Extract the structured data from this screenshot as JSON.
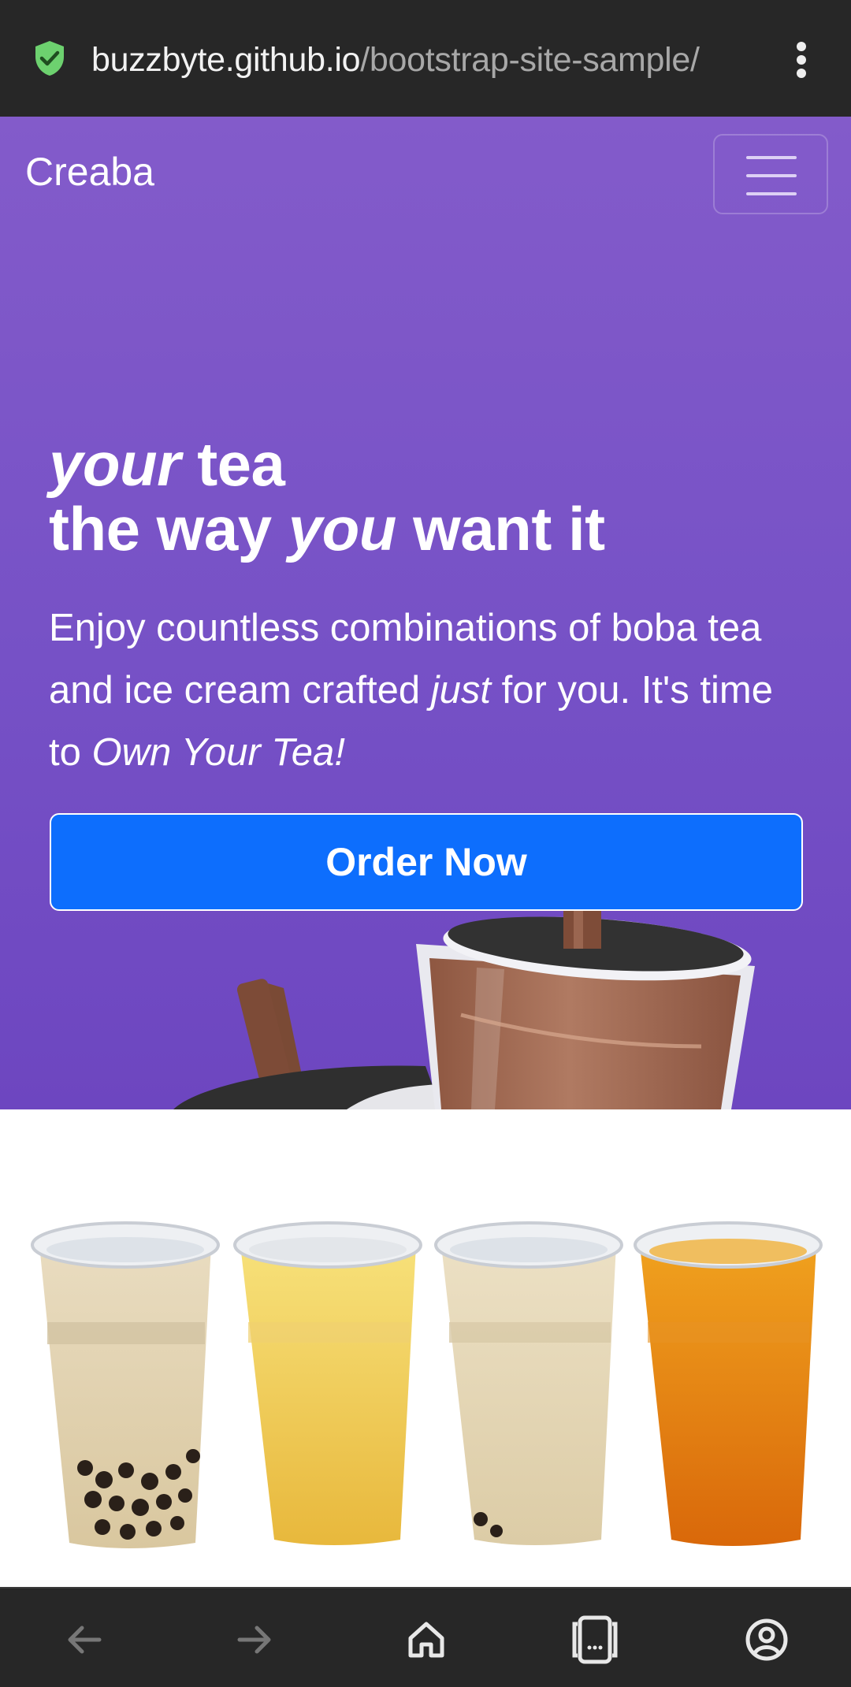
{
  "browser": {
    "url_host": "buzzbyte.github.io",
    "url_path": "/bootstrap-site-sample/",
    "icons": [
      "shield-check-icon",
      "kebab-menu-icon"
    ]
  },
  "navbar": {
    "brand": "Creaba",
    "toggler_icon": "hamburger-icon"
  },
  "hero": {
    "headline_line1_em": "your",
    "headline_line1_rest": " tea",
    "headline_line2_a": "the way ",
    "headline_line2_em": "you",
    "headline_line2_b": " want it",
    "lead_a": "Enjoy countless combinations of boba tea and ice cream crafted ",
    "lead_em": "just",
    "lead_b": " for you. It's time to ",
    "lead_em2": "Own Your Tea!",
    "cta_label": "Order Now",
    "cta_color": "#0d6efd"
  },
  "colors": {
    "hero_top": "#835bca",
    "hero_bottom": "#6d46c0"
  },
  "bottom_nav": {
    "items": [
      "back-arrow-icon",
      "forward-arrow-icon",
      "home-icon",
      "tabs-icon",
      "account-icon"
    ]
  }
}
